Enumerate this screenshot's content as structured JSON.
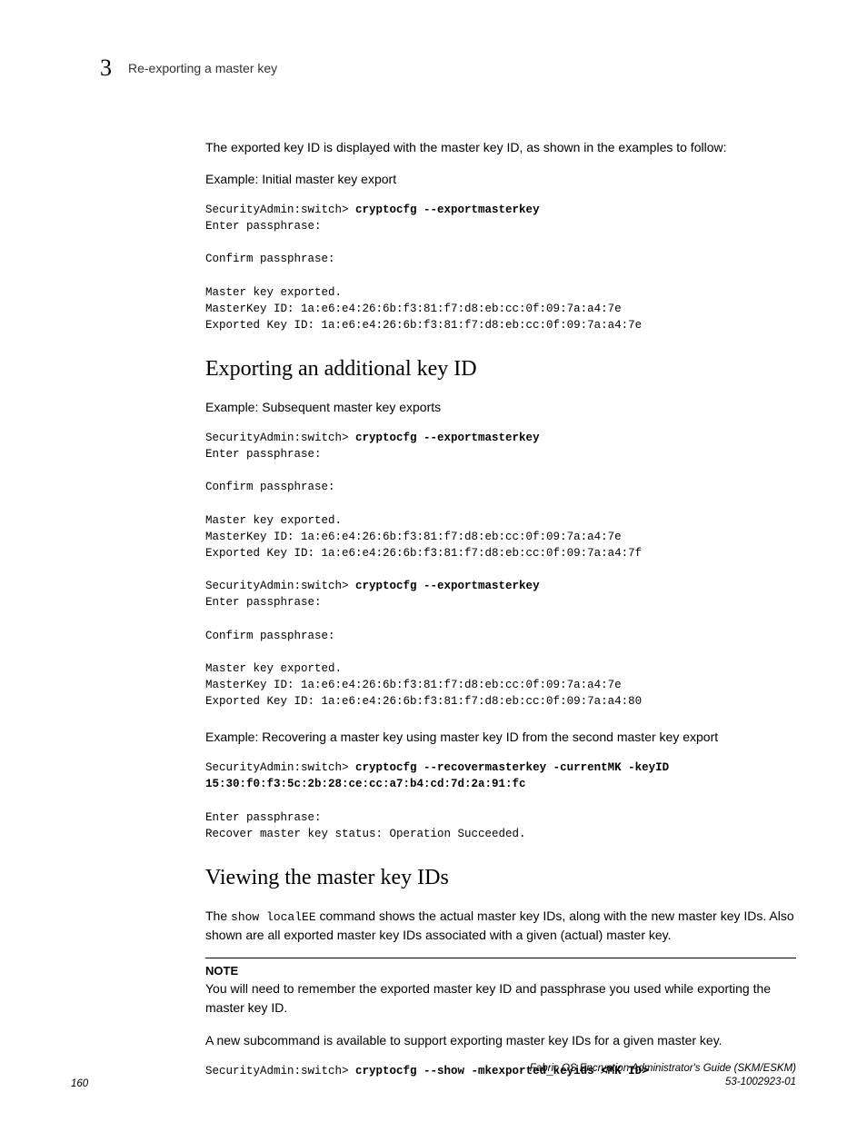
{
  "header": {
    "chapter_number": "3",
    "running_title": "Re-exporting a master key"
  },
  "content": {
    "intro_para": "The exported key ID is displayed with the master key ID, as shown in the examples to follow:",
    "example1_label": "Example: Initial master key export",
    "code1": {
      "prompt1": "SecurityAdmin:switch> ",
      "cmd1": "cryptocfg --exportmasterkey",
      "l2": "Enter passphrase:",
      "l3": "",
      "l4": "Confirm passphrase:",
      "l5": "",
      "l6": "Master key exported.",
      "l7": "MasterKey ID: 1a:e6:e4:26:6b:f3:81:f7:d8:eb:cc:0f:09:7a:a4:7e",
      "l8": "Exported Key ID: 1a:e6:e4:26:6b:f3:81:f7:d8:eb:cc:0f:09:7a:a4:7e"
    },
    "section2_title": "Exporting an additional key ID",
    "example2_label": "Example: Subsequent master key exports",
    "code2": {
      "prompt1": "SecurityAdmin:switch> ",
      "cmd1": "cryptocfg --exportmasterkey",
      "l2": "Enter passphrase:",
      "l3": "",
      "l4": "Confirm passphrase:",
      "l5": "",
      "l6": "Master key exported.",
      "l7": "MasterKey ID: 1a:e6:e4:26:6b:f3:81:f7:d8:eb:cc:0f:09:7a:a4:7e",
      "l8": "Exported Key ID: 1a:e6:e4:26:6b:f3:81:f7:d8:eb:cc:0f:09:7a:a4:7f",
      "l9": "",
      "prompt2": "SecurityAdmin:switch> ",
      "cmd2": "cryptocfg --exportmasterkey",
      "l11": "Enter passphrase:",
      "l12": "",
      "l13": "Confirm passphrase:",
      "l14": "",
      "l15": "Master key exported.",
      "l16": "MasterKey ID: 1a:e6:e4:26:6b:f3:81:f7:d8:eb:cc:0f:09:7a:a4:7e",
      "l17": "Exported Key ID: 1a:e6:e4:26:6b:f3:81:f7:d8:eb:cc:0f:09:7a:a4:80"
    },
    "example3_label": "Example: Recovering a master key using master key ID from the second master key export",
    "code3": {
      "prompt1": "SecurityAdmin:switch> ",
      "cmd1": "cryptocfg --recovermasterkey -currentMK -keyID ",
      "cmd1b": "15:30:f0:f3:5c:2b:28:ce:cc:a7:b4:cd:7d:2a:91:fc",
      "l2": "",
      "l3": "Enter passphrase:",
      "l4": "Recover master key status: Operation Succeeded."
    },
    "section3_title": "Viewing the master key IDs",
    "para3a_pre": "The ",
    "para3a_code": "show localEE",
    "para3a_post": " command shows the actual master key IDs, along with the new master key IDs. Also shown are all exported master key IDs associated with a given (actual) master key.",
    "note_label": "NOTE",
    "note_text": "You will need to remember the exported master key ID and passphrase you used while exporting the master key ID.",
    "para3b": "A new subcommand is available to support exporting master key IDs for a given master key.",
    "code4": {
      "prompt1": "SecurityAdmin:switch> ",
      "cmd1": "cryptocfg --show -mkexported_keyids <MK ID>"
    }
  },
  "footer": {
    "page_number": "160",
    "doc_title": "Fabric OS Encryption Administrator's Guide (SKM/ESKM)",
    "doc_id": "53-1002923-01"
  }
}
